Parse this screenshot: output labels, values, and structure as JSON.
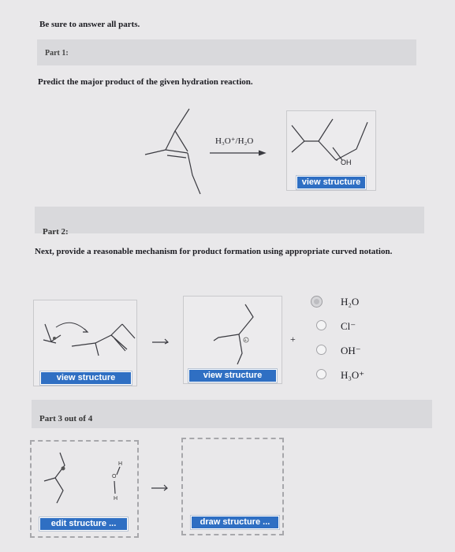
{
  "instructions": "Be sure to answer all parts.",
  "part1": {
    "label": "Part 1:",
    "prompt": "Predict the major product of the given hydration reaction.",
    "reagent": "H₃O⁺/H₂O",
    "product_label": "OH",
    "view_button": "view structure"
  },
  "part2": {
    "label": "Part 2:",
    "prompt": "Next, provide a reasonable mechanism for product formation using appropriate curved notation.",
    "left_button": "view structure",
    "right_button": "view structure",
    "plus": "+",
    "options": [
      "H₂O",
      "Cl⁻",
      "OH⁻",
      "H₃O⁺"
    ],
    "selected_option": 0
  },
  "part3": {
    "label": "Part 3 out of 4",
    "edit_button": "edit structure ...",
    "draw_button": "draw structure ..."
  },
  "colors": {
    "button": "#2f6fc3",
    "bar": "#d9d9dc",
    "background": "#e9e8ea"
  }
}
